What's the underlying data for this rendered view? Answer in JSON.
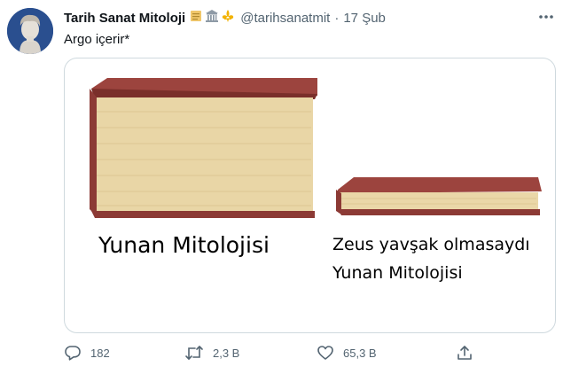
{
  "tweet": {
    "author": {
      "display_name": "Tarih Sanat Mitoloji",
      "emojis": [
        "scroll-emoji",
        "classical-building-emoji",
        "fleur-de-lis-emoji"
      ],
      "handle": "@tarihsanatmit",
      "separator": "·",
      "date": "17 Şub"
    },
    "text": "Argo içerir*",
    "media": {
      "caption_left": "Yunan Mitolojisi",
      "caption_right_line1": "Zeus yavşak olmasaydı",
      "caption_right_line2": "Yunan Mitolojisi"
    },
    "actions": {
      "reply_count": "182",
      "retweet_count": "2,3 B",
      "like_count": "65,3 B"
    }
  },
  "colors": {
    "text_primary": "#0f1419",
    "text_secondary": "#536471",
    "border": "#cfd9de",
    "book_cover": "#8c3a35",
    "book_pages": "#e6d2a1"
  }
}
